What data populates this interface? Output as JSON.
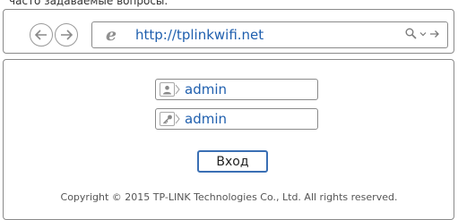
{
  "page": {
    "caption": "часто задаваемые вопросы."
  },
  "browser": {
    "url": "http://tplinkwifi.net"
  },
  "login": {
    "username": "admin",
    "password": "admin",
    "button_label": "Вход"
  },
  "footer": {
    "copyright": "Copyright © 2015 TP-LINK Technologies Co., Ltd. All rights reserved."
  },
  "icons": {
    "back": "back-arrow-icon",
    "forward": "forward-arrow-icon",
    "browser": "ie-logo-icon",
    "search": "search-icon",
    "user": "user-icon",
    "key": "key-icon"
  },
  "colors": {
    "link_blue": "#1f5fae",
    "button_border": "#3a6fb4",
    "frame_gray": "#8a8a8a"
  }
}
